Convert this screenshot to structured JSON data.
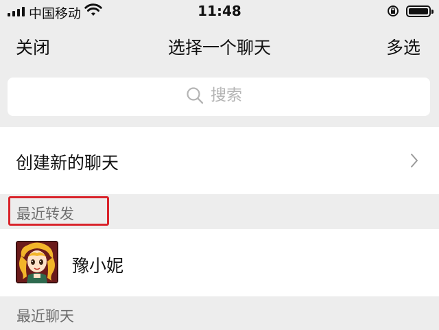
{
  "status_bar": {
    "carrier": "中国移动",
    "time": "11:48",
    "signal_icon": "signal-bars-icon",
    "wifi_icon": "wifi-icon",
    "rotation_lock_icon": "rotation-lock-icon",
    "battery_icon": "battery-icon"
  },
  "nav": {
    "close_label": "关闭",
    "title": "选择一个聊天",
    "multi_select_label": "多选"
  },
  "search": {
    "placeholder": "搜索",
    "icon": "search-icon"
  },
  "new_chat": {
    "label": "创建新的聊天",
    "icon": "chevron-right-icon"
  },
  "recent_forward": {
    "header": "最近转发",
    "highlight_color": "#d9232a",
    "items": [
      {
        "name": "豫小妮",
        "avatar": "cartoon-girl-avatar"
      }
    ]
  },
  "recent_chats": {
    "header": "最近聊天"
  },
  "colors": {
    "background": "#ededed",
    "section_header_text": "#6f6f6f",
    "placeholder_text": "#b4b4b4"
  }
}
